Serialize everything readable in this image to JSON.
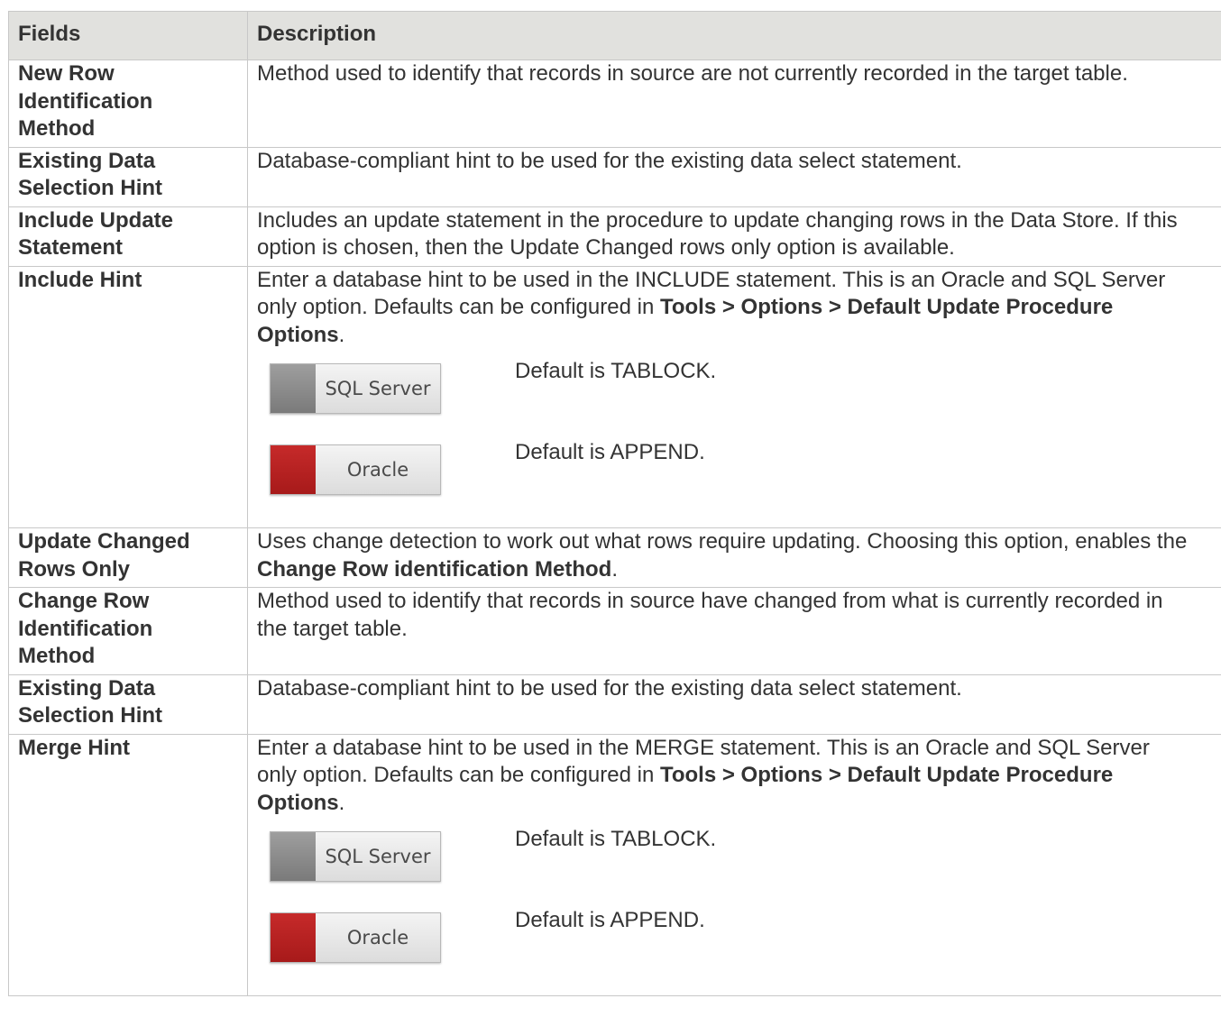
{
  "table": {
    "header": {
      "fields": "Fields",
      "description": "Description"
    },
    "rows": [
      {
        "field": "New Row Identification Method",
        "description": "Method used to identify that records in source are not currently recorded in the target table."
      },
      {
        "field": "Existing Data Selection Hint",
        "description": "Database-compliant hint to be used for the existing data select statement."
      },
      {
        "field": "Include Update Statement",
        "description": "Includes an update statement in the procedure to update changing rows in the Data Store. If this option is chosen, then the Update Changed rows only option is available."
      },
      {
        "field": "Include Hint",
        "description_pre": "Enter a database hint to be used in the INCLUDE statement. This is an Oracle and SQL Server only option. Defaults can be configured in ",
        "description_bold": "Tools > Options > Default Update Procedure Options",
        "description_post": ".",
        "hints": [
          {
            "db": "SQL Server",
            "text": "Default is TABLOCK.",
            "color": "#8c8c8c"
          },
          {
            "db": "Oracle",
            "text": "Default is APPEND.",
            "color": "#b82222"
          }
        ]
      },
      {
        "field": "Update Changed Rows Only",
        "description_pre": "Uses change detection to work out what rows require updating. Choosing this option, enables the ",
        "description_bold": "Change Row identification Method",
        "description_post": "."
      },
      {
        "field": "Change Row Identification Method",
        "description": "Method used to identify that records in source have changed from what is currently recorded in the target table."
      },
      {
        "field": "Existing Data Selection Hint",
        "description": "Database-compliant hint to be used for the existing data select statement."
      },
      {
        "field": "Merge Hint",
        "description_pre": "Enter a database hint to be used in the MERGE statement. This is an Oracle and SQL Server only option. Defaults can be configured in ",
        "description_bold": "Tools > Options > Default Update Procedure Options",
        "description_post": ".",
        "hints": [
          {
            "db": "SQL Server",
            "text": "Default is TABLOCK.",
            "color": "#8c8c8c"
          },
          {
            "db": "Oracle",
            "text": "Default is APPEND.",
            "color": "#b82222"
          }
        ]
      }
    ]
  }
}
